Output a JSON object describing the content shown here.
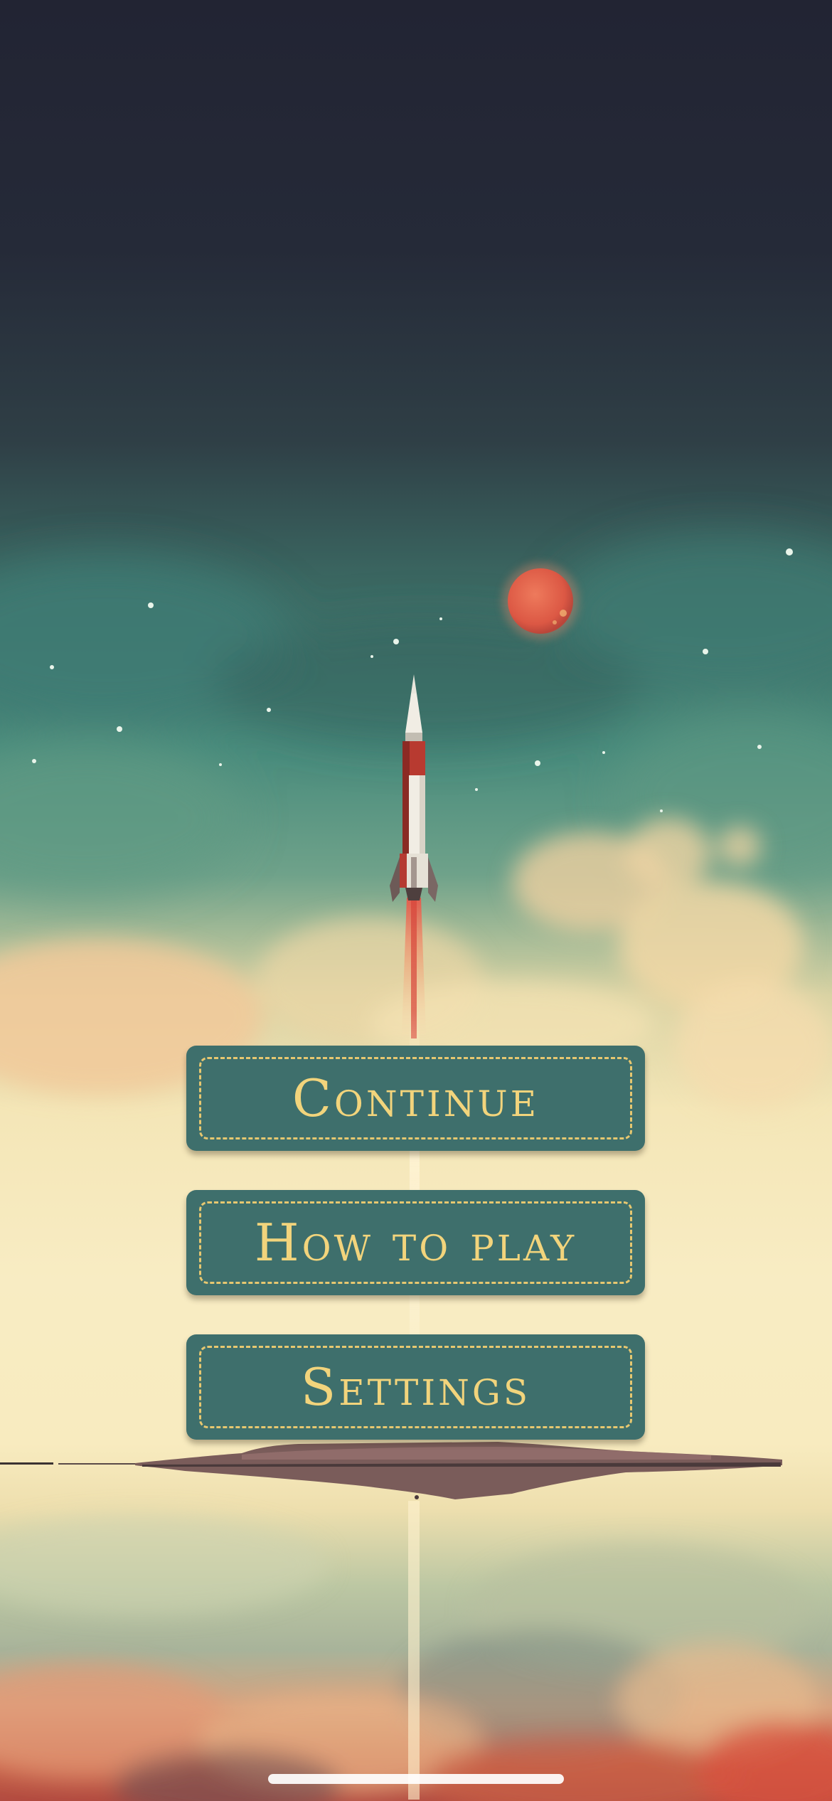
{
  "menu": {
    "items": [
      {
        "label": "Continue"
      },
      {
        "label": "How to play"
      },
      {
        "label": "Settings"
      }
    ]
  },
  "colors": {
    "button_fill": "#3e6f6c",
    "button_text": "#f2d47c",
    "button_dash": "#e6c770",
    "planet": "#e2624f",
    "rocket_red": "#b83a30",
    "rocket_white": "#f1ede4",
    "sky_top": "#222433",
    "sky_teal": "#488b7c",
    "horizon_cream": "#f8ecc3"
  },
  "icons": {
    "rocket": "rocket-illustration",
    "planet": "red-planet",
    "stars": "star-dots"
  }
}
